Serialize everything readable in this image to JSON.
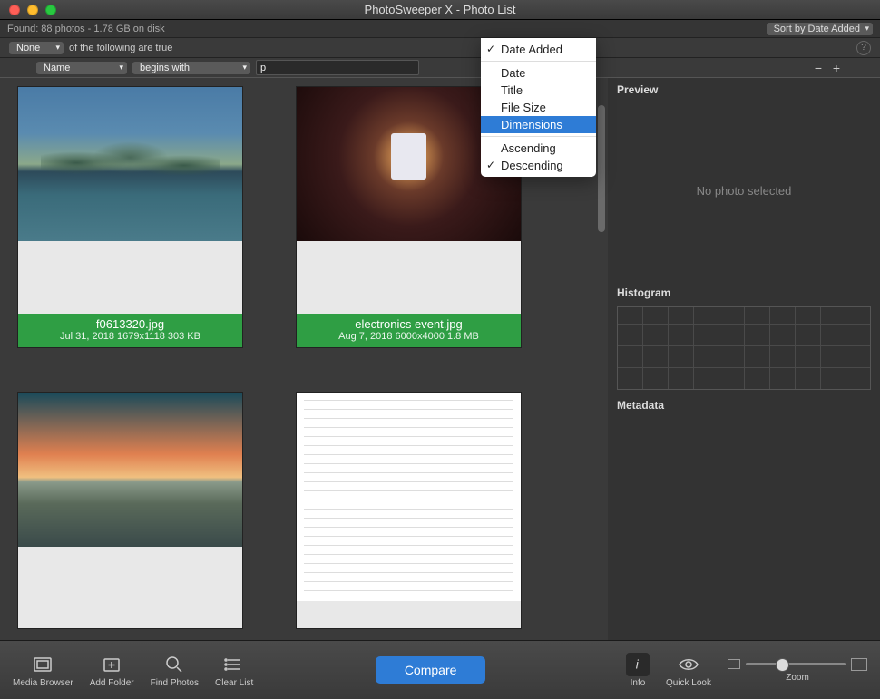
{
  "window": {
    "title": "PhotoSweeper X - Photo List"
  },
  "status": {
    "found_text": "Found: 88 photos - 1.78 GB on disk",
    "sort_label": "Sort by Date Added"
  },
  "filter1": {
    "match": "None",
    "suffix": "of the following are true"
  },
  "filter2": {
    "field": "Name",
    "op": "begins with",
    "value": "p"
  },
  "cards": [
    {
      "filename": "f0613320.jpg",
      "meta": "Jul 31, 2018   1679x1118   303 KB"
    },
    {
      "filename": "electronics event.jpg",
      "meta": "Aug 7, 2018   6000x4000   1.8 MB"
    }
  ],
  "sort_menu": {
    "items": [
      {
        "label": "Date Added",
        "checked": true
      },
      {
        "label": "Date"
      },
      {
        "label": "Title"
      },
      {
        "label": "File Size"
      },
      {
        "label": "Dimensions",
        "highlight": true
      }
    ],
    "order": [
      {
        "label": "Ascending"
      },
      {
        "label": "Descending",
        "checked": true
      }
    ]
  },
  "side": {
    "preview_title": "Preview",
    "preview_empty": "No photo selected",
    "histogram_title": "Histogram",
    "metadata_title": "Metadata"
  },
  "toolbar": {
    "media_browser": "Media Browser",
    "add_folder": "Add Folder",
    "find_photos": "Find Photos",
    "clear_list": "Clear List",
    "compare": "Compare",
    "info": "Info",
    "quick_look": "Quick Look",
    "zoom": "Zoom"
  }
}
